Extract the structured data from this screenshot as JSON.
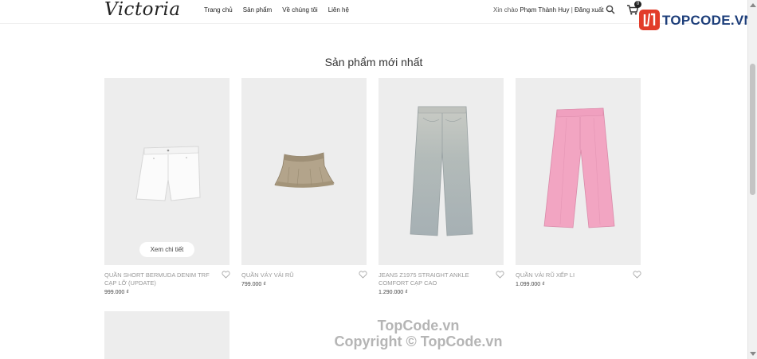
{
  "header": {
    "logo": "Victoria",
    "nav": [
      "Trang chủ",
      "Sản phẩm",
      "Về chúng tôi",
      "Liên hệ"
    ],
    "greeting_prefix": "Xin chào",
    "user_name": "Phạm Thành Huy",
    "separator": "|",
    "logout": "Đăng xuất",
    "cart_count": "0"
  },
  "watermark": {
    "logo_text": "TOPCODE.VN",
    "site": "TopCode.vn",
    "copyright": "Copyright © TopCode.vn"
  },
  "section": {
    "title": "Sản phẩm mới nhất",
    "details_button": "Xem chi tiết"
  },
  "products": [
    {
      "name": "QUẦN SHORT BERMUDA DENIM TRF CẠP LỠ (UPDATE)",
      "price": "999.000 ₫"
    },
    {
      "name": "QUẦN VÁY VẢI RŨ",
      "price": "799.000 ₫"
    },
    {
      "name": "JEANS Z1975 STRAIGHT ANKLE COMFORT CẠP CAO",
      "price": "1.290.000 ₫"
    },
    {
      "name": "QUẦN VẢI RŨ XẾP LI",
      "price": "1.099.000 ₫"
    }
  ],
  "colors": {
    "thumb_bg": "#ededed",
    "brand_red": "#e23c2a",
    "brand_blue": "#1d3e7a"
  }
}
